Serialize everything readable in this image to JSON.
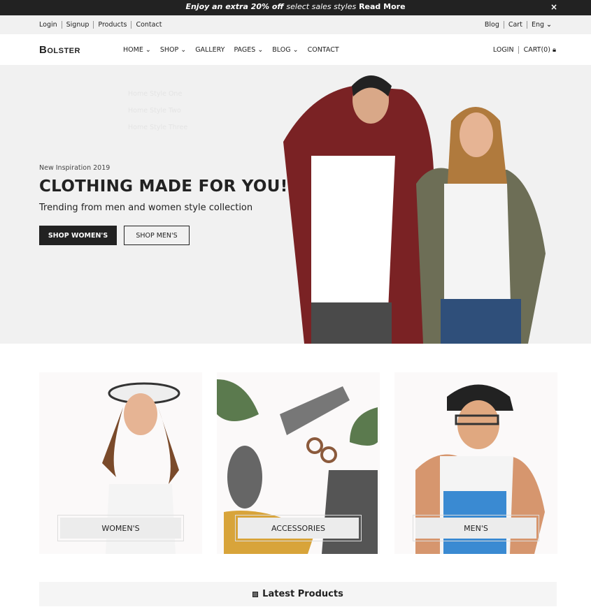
{
  "promo": {
    "bold": "Enjoy an extra 20% off",
    "light": "select sales styles",
    "link": "Read More",
    "close": "×"
  },
  "topbar": {
    "left": [
      "Login",
      "Signup",
      "Products",
      "Contact"
    ],
    "right": [
      "Blog",
      "Cart"
    ],
    "lang": "Eng"
  },
  "nav": {
    "logo": "Bolster",
    "items": [
      {
        "label": "HOME",
        "dropdown": true
      },
      {
        "label": "SHOP",
        "dropdown": true
      },
      {
        "label": "GALLERY",
        "dropdown": false
      },
      {
        "label": "PAGES",
        "dropdown": true
      },
      {
        "label": "BLOG",
        "dropdown": true
      },
      {
        "label": "CONTACT",
        "dropdown": false
      }
    ],
    "login": "LOGIN",
    "cart": "CART(0)"
  },
  "home_dropdown": [
    "Home Style One",
    "Home Style Two",
    "Home Style Three"
  ],
  "hero": {
    "eyebrow": "New Inspiration 2019",
    "title": "CLOTHING MADE FOR YOU!",
    "subtitle": "Trending from men and women style collection",
    "btn_women": "SHOP WOMEN'S",
    "btn_men": "SHOP MEN'S"
  },
  "categories": [
    "WOMEN'S",
    "ACCESSORIES",
    "MEN'S"
  ],
  "latest": {
    "title": "Latest Products"
  }
}
